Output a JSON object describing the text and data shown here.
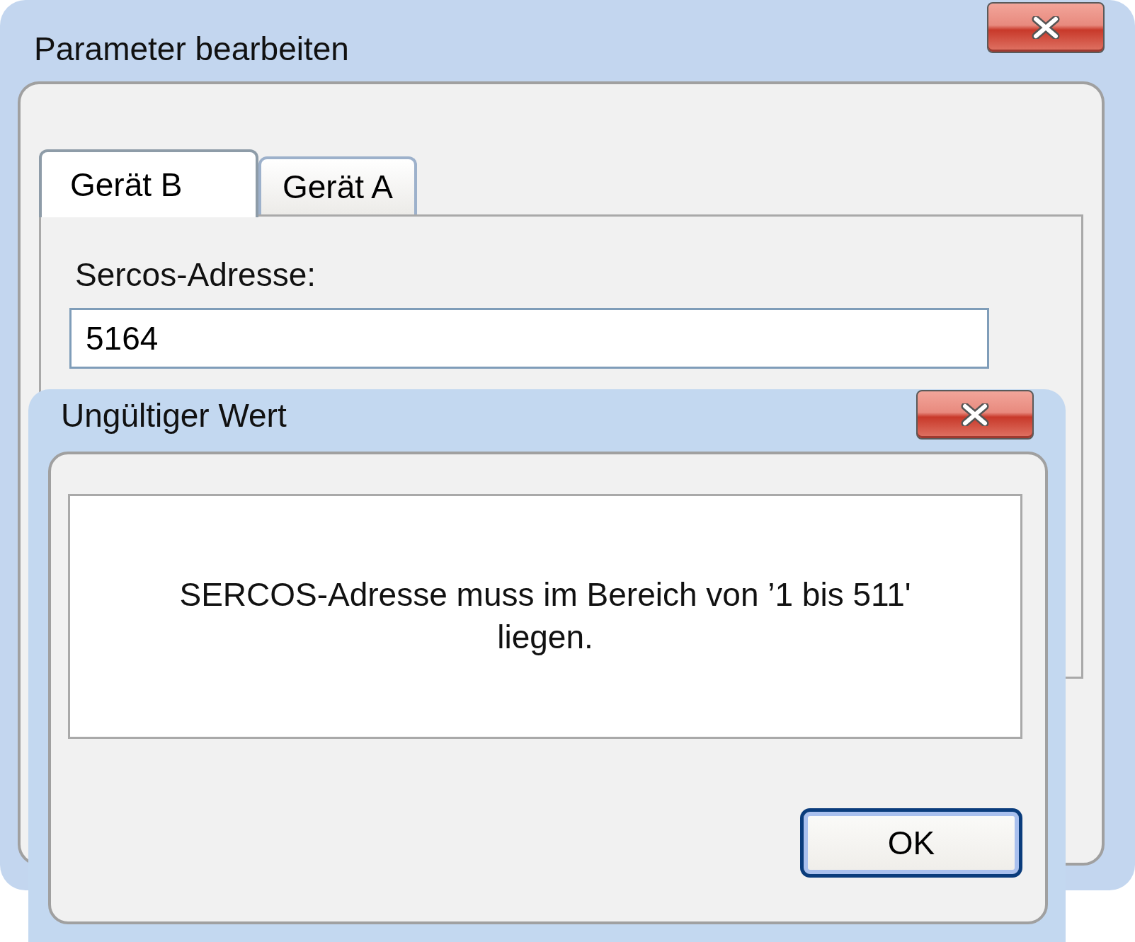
{
  "window": {
    "title": "Parameter bearbeiten"
  },
  "tabs": [
    {
      "label": "Gerät B",
      "selected": true
    },
    {
      "label": "Gerät A",
      "selected": false
    }
  ],
  "field": {
    "label": "Sercos-Adresse:",
    "value": "5164"
  },
  "dialog": {
    "title": "Ungültiger Wert",
    "message": "SERCOS-Adresse muss im Bereich von ’1 bis 511' liegen.",
    "buttons": [
      "OK"
    ]
  }
}
